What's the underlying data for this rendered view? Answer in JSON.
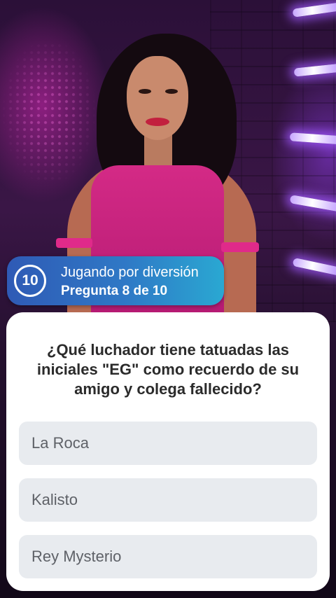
{
  "status": {
    "timer_value": "10",
    "mode_label": "Jugando por diversión",
    "progress_label": "Pregunta 8 de 10"
  },
  "quiz": {
    "question": "¿Qué luchador tiene tatuadas las iniciales \"EG\" como recuerdo de su amigo y colega fallecido?",
    "options": [
      "La Roca",
      "Kalisto",
      "Rey Mysterio"
    ]
  }
}
